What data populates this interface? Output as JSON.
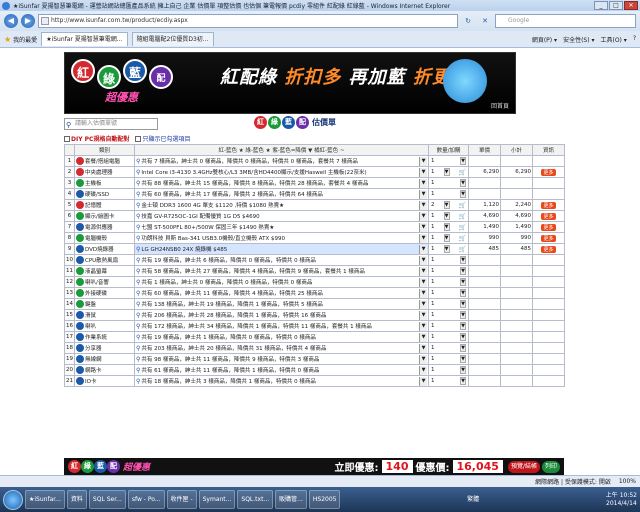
{
  "window": {
    "title": "★iSunfar 夏揚智慧筆電網 - 運營站網站總匯產品系統 擁上自己 企業 估價單 項整估價 也估個 筆電報價 pcdiy 零組件 紅配綠 紅綠藍 - Windows Internet Explorer",
    "btn_min": "_",
    "btn_max": "□",
    "btn_close": "✕"
  },
  "addressbar": {
    "url": "http://www.isunfar.com.tw/product/ecdiy.aspx",
    "search_placeholder": "Google",
    "back": "◀",
    "forward": "▶",
    "refresh": "↻",
    "stop": "✕"
  },
  "tabbar": {
    "favorites": "我的最愛",
    "tabs": [
      "★iSunfar 夏揚智慧筆電網...",
      "隨組電腦配2位優質D3初..."
    ],
    "tools": [
      "網頁(P) ▾",
      "安全性(S) ▾",
      "工具(O) ▾",
      "?"
    ]
  },
  "banner": {
    "c1": "紅",
    "c2": "綠",
    "c3": "藍",
    "c4": "配",
    "slogan": "超優惠",
    "headline_a": "紅配綠",
    "headline_b": "折扣多",
    "headline_c": "再加藍",
    "headline_d": "折更多",
    "home": "回首頁"
  },
  "toolbar": {
    "search_placeholder": "請輸入估價單號",
    "title_c1": "紅",
    "title_c2": "綠",
    "title_c3": "藍",
    "title_c4": "配",
    "title_label": "估價單"
  },
  "options": {
    "opt1": "DIY PC規格自動配對",
    "opt2": "只顯示已勾選項目"
  },
  "table": {
    "h_no": "",
    "h_cat": "類別",
    "h_sel": "紅-藍色 ★ 綠-藍色 ★ 紫-藍色=降價 ▼ 橘紅-藍色 ~",
    "h_qty": "數量/加購",
    "h_price": "單價",
    "h_sub": "小計",
    "h_info": "資訊",
    "rows": [
      {
        "no": "1",
        "cat": "套餐/搭組電腦",
        "sel": "共有 7 樣商品，紳士共 0 樣商品，降價共 0 樣商品，特價共 0 樣商品，套餐共 7 樣商品",
        "qty": "1",
        "price": "",
        "sub": "",
        "info": false,
        "color": "#d4292f"
      },
      {
        "no": "2",
        "cat": "中央處理器",
        "sel": "Intel Core i3-4130 3.4GHz雙核心/L3 3MB/含HD4400顯示/支援Haswell 主機板(22奈米)",
        "qty": "1",
        "price": "6,290",
        "sub": "6,290",
        "info": true,
        "color": "#d4292f"
      },
      {
        "no": "3",
        "cat": "主機板",
        "sel": "共有 88 樣商品，紳士共 15 樣商品，降價共 8 樣商品，特價共 28 樣商品，套餐共 4 樣商品",
        "qty": "1",
        "price": "",
        "sub": "",
        "info": false,
        "color": "#1a9a3a"
      },
      {
        "no": "4",
        "cat": "硬碟/SSD",
        "sel": "共有 60 樣商品，紳士共 17 樣商品，降價共 2 樣商品，特價共 64 樣商品",
        "qty": "1",
        "price": "",
        "sub": "",
        "info": false,
        "color": "#1a5aa8"
      },
      {
        "no": "5",
        "cat": "記憶體",
        "sel": "金士頓 DDR3 1600 4G 單支 $1120 ,特價 $1080 熱賣★",
        "qty": "2",
        "price": "1,120",
        "sub": "2,240",
        "info": true,
        "color": "#d4292f"
      },
      {
        "no": "6",
        "cat": "顯示/繪圖卡",
        "sel": "技嘉 GV-R725OC-1GI 配備優質 1G D5 $4690",
        "qty": "1",
        "price": "4,690",
        "sub": "4,690",
        "info": true,
        "color": "#1a9a3a"
      },
      {
        "no": "7",
        "cat": "電源供應器",
        "sel": "七盟 ST-500PFL 80+/500W 保固三年 $1490 熱賣★",
        "qty": "1",
        "price": "1,490",
        "sub": "1,490",
        "info": true,
        "color": "#1a5aa8"
      },
      {
        "no": "8",
        "cat": "電腦機殼",
        "sel": "功朗科技 貝斯 Bas-341 USB3.0機殼/直立機殼 ATX $990",
        "qty": "1",
        "price": "990",
        "sub": "990",
        "info": true,
        "color": "#1a9a3a"
      },
      {
        "no": "9",
        "cat": "DVD燒錄器",
        "sel": "LG GH24NSB0 24X 燒錄機 $485",
        "qty": "1",
        "price": "485",
        "sub": "485",
        "info": true,
        "color": "#1a5aa8",
        "highlight": true
      },
      {
        "no": "10",
        "cat": "CPU散熱風扇",
        "sel": "共有 19 樣商品，紳士共 6 樣商品，降價共 0 樣商品，特價共 0 樣商品",
        "qty": "1",
        "price": "",
        "sub": "",
        "info": false,
        "color": "#1a5aa8"
      },
      {
        "no": "11",
        "cat": "液晶螢幕",
        "sel": "共有 58 樣商品，紳士共 27 樣商品，降價共 4 樣商品，特價共 9 樣商品，套餐共 1 樣商品",
        "qty": "1",
        "price": "",
        "sub": "",
        "info": false,
        "color": "#1a9a3a"
      },
      {
        "no": "12",
        "cat": "喇叭/音響",
        "sel": "共有 1 樣商品，紳士共 0 樣商品，降價共 0 樣商品，特價共 0 樣商品",
        "qty": "1",
        "price": "",
        "sub": "",
        "info": false,
        "color": "#1a9a3a"
      },
      {
        "no": "13",
        "cat": "外接硬碟",
        "sel": "共有 60 樣商品，紳士共 11 樣商品，降價共 4 樣商品，特價共 25 樣商品",
        "qty": "1",
        "price": "",
        "sub": "",
        "info": false,
        "color": "#1a9a3a"
      },
      {
        "no": "14",
        "cat": "鍵盤",
        "sel": "共有 138 樣商品，紳士共 19 樣商品，降價共 1 樣商品，特價共 5 樣商品",
        "qty": "1",
        "price": "",
        "sub": "",
        "info": false,
        "color": "#1a9a3a"
      },
      {
        "no": "15",
        "cat": "滑鼠",
        "sel": "共有 206 樣商品，紳士共 28 樣商品，降價共 1 樣商品，特價共 16 樣商品",
        "qty": "1",
        "price": "",
        "sub": "",
        "info": false,
        "color": "#1a5aa8"
      },
      {
        "no": "16",
        "cat": "喇叭",
        "sel": "共有 172 樣商品，紳士共 34 樣商品，降價共 1 樣商品，特價共 11 樣商品，套餐共 1 樣商品",
        "qty": "1",
        "price": "",
        "sub": "",
        "info": false,
        "color": "#1a5aa8"
      },
      {
        "no": "17",
        "cat": "作業系統",
        "sel": "共有 19 樣商品，紳士共 1 樣商品，降價共 0 樣商品，特價共 0 樣商品",
        "qty": "1",
        "price": "",
        "sub": "",
        "info": false,
        "color": "#1a5aa8"
      },
      {
        "no": "18",
        "cat": "分享器",
        "sel": "共有 203 樣商品，紳士共 20 樣商品，降價共 31 樣商品，特價共 4 樣商品",
        "qty": "1",
        "price": "",
        "sub": "",
        "info": false,
        "color": "#1a5aa8"
      },
      {
        "no": "19",
        "cat": "無線網",
        "sel": "共有 98 樣商品，紳士共 11 樣商品，降價共 9 樣商品，特價共 3 樣商品",
        "qty": "1",
        "price": "",
        "sub": "",
        "info": false,
        "color": "#1a5aa8"
      },
      {
        "no": "20",
        "cat": "網路卡",
        "sel": "共有 61 樣商品，紳士共 11 樣商品，降價共 1 樣商品，特價共 0 樣商品",
        "qty": "1",
        "price": "",
        "sub": "",
        "info": false,
        "color": "#1a5aa8"
      },
      {
        "no": "21",
        "cat": "IO卡",
        "sel": "共有 18 樣商品，紳士共 3 樣商品，降價共 1 樣商品，特價共 0 樣商品",
        "qty": "1",
        "price": "",
        "sub": "",
        "info": false,
        "color": "#1a5aa8"
      }
    ],
    "info_label": "更多"
  },
  "footer": {
    "c1": "紅",
    "c2": "綠",
    "c3": "藍",
    "c4": "配",
    "slogan": "超優惠",
    "discount_label": "立即優惠:",
    "discount_value": "140",
    "price_label": "優惠價:",
    "price_value": "16,045",
    "btn_order": "預覽/結帳",
    "btn_print": "列印"
  },
  "statusbar": {
    "zone": "網際網路 | 受保護模式: 開啟",
    "zoom": "100%"
  },
  "taskbar": {
    "items": [
      "★iSunfar...",
      "資料",
      "SQL Ser...",
      "sfw - Po...",
      "收件匣 -",
      "Symant...",
      "SQL.txt...",
      "販購管...",
      "HS2005"
    ],
    "time": "上午 10:52",
    "date": "2014/4/14",
    "lang": "繁體"
  }
}
